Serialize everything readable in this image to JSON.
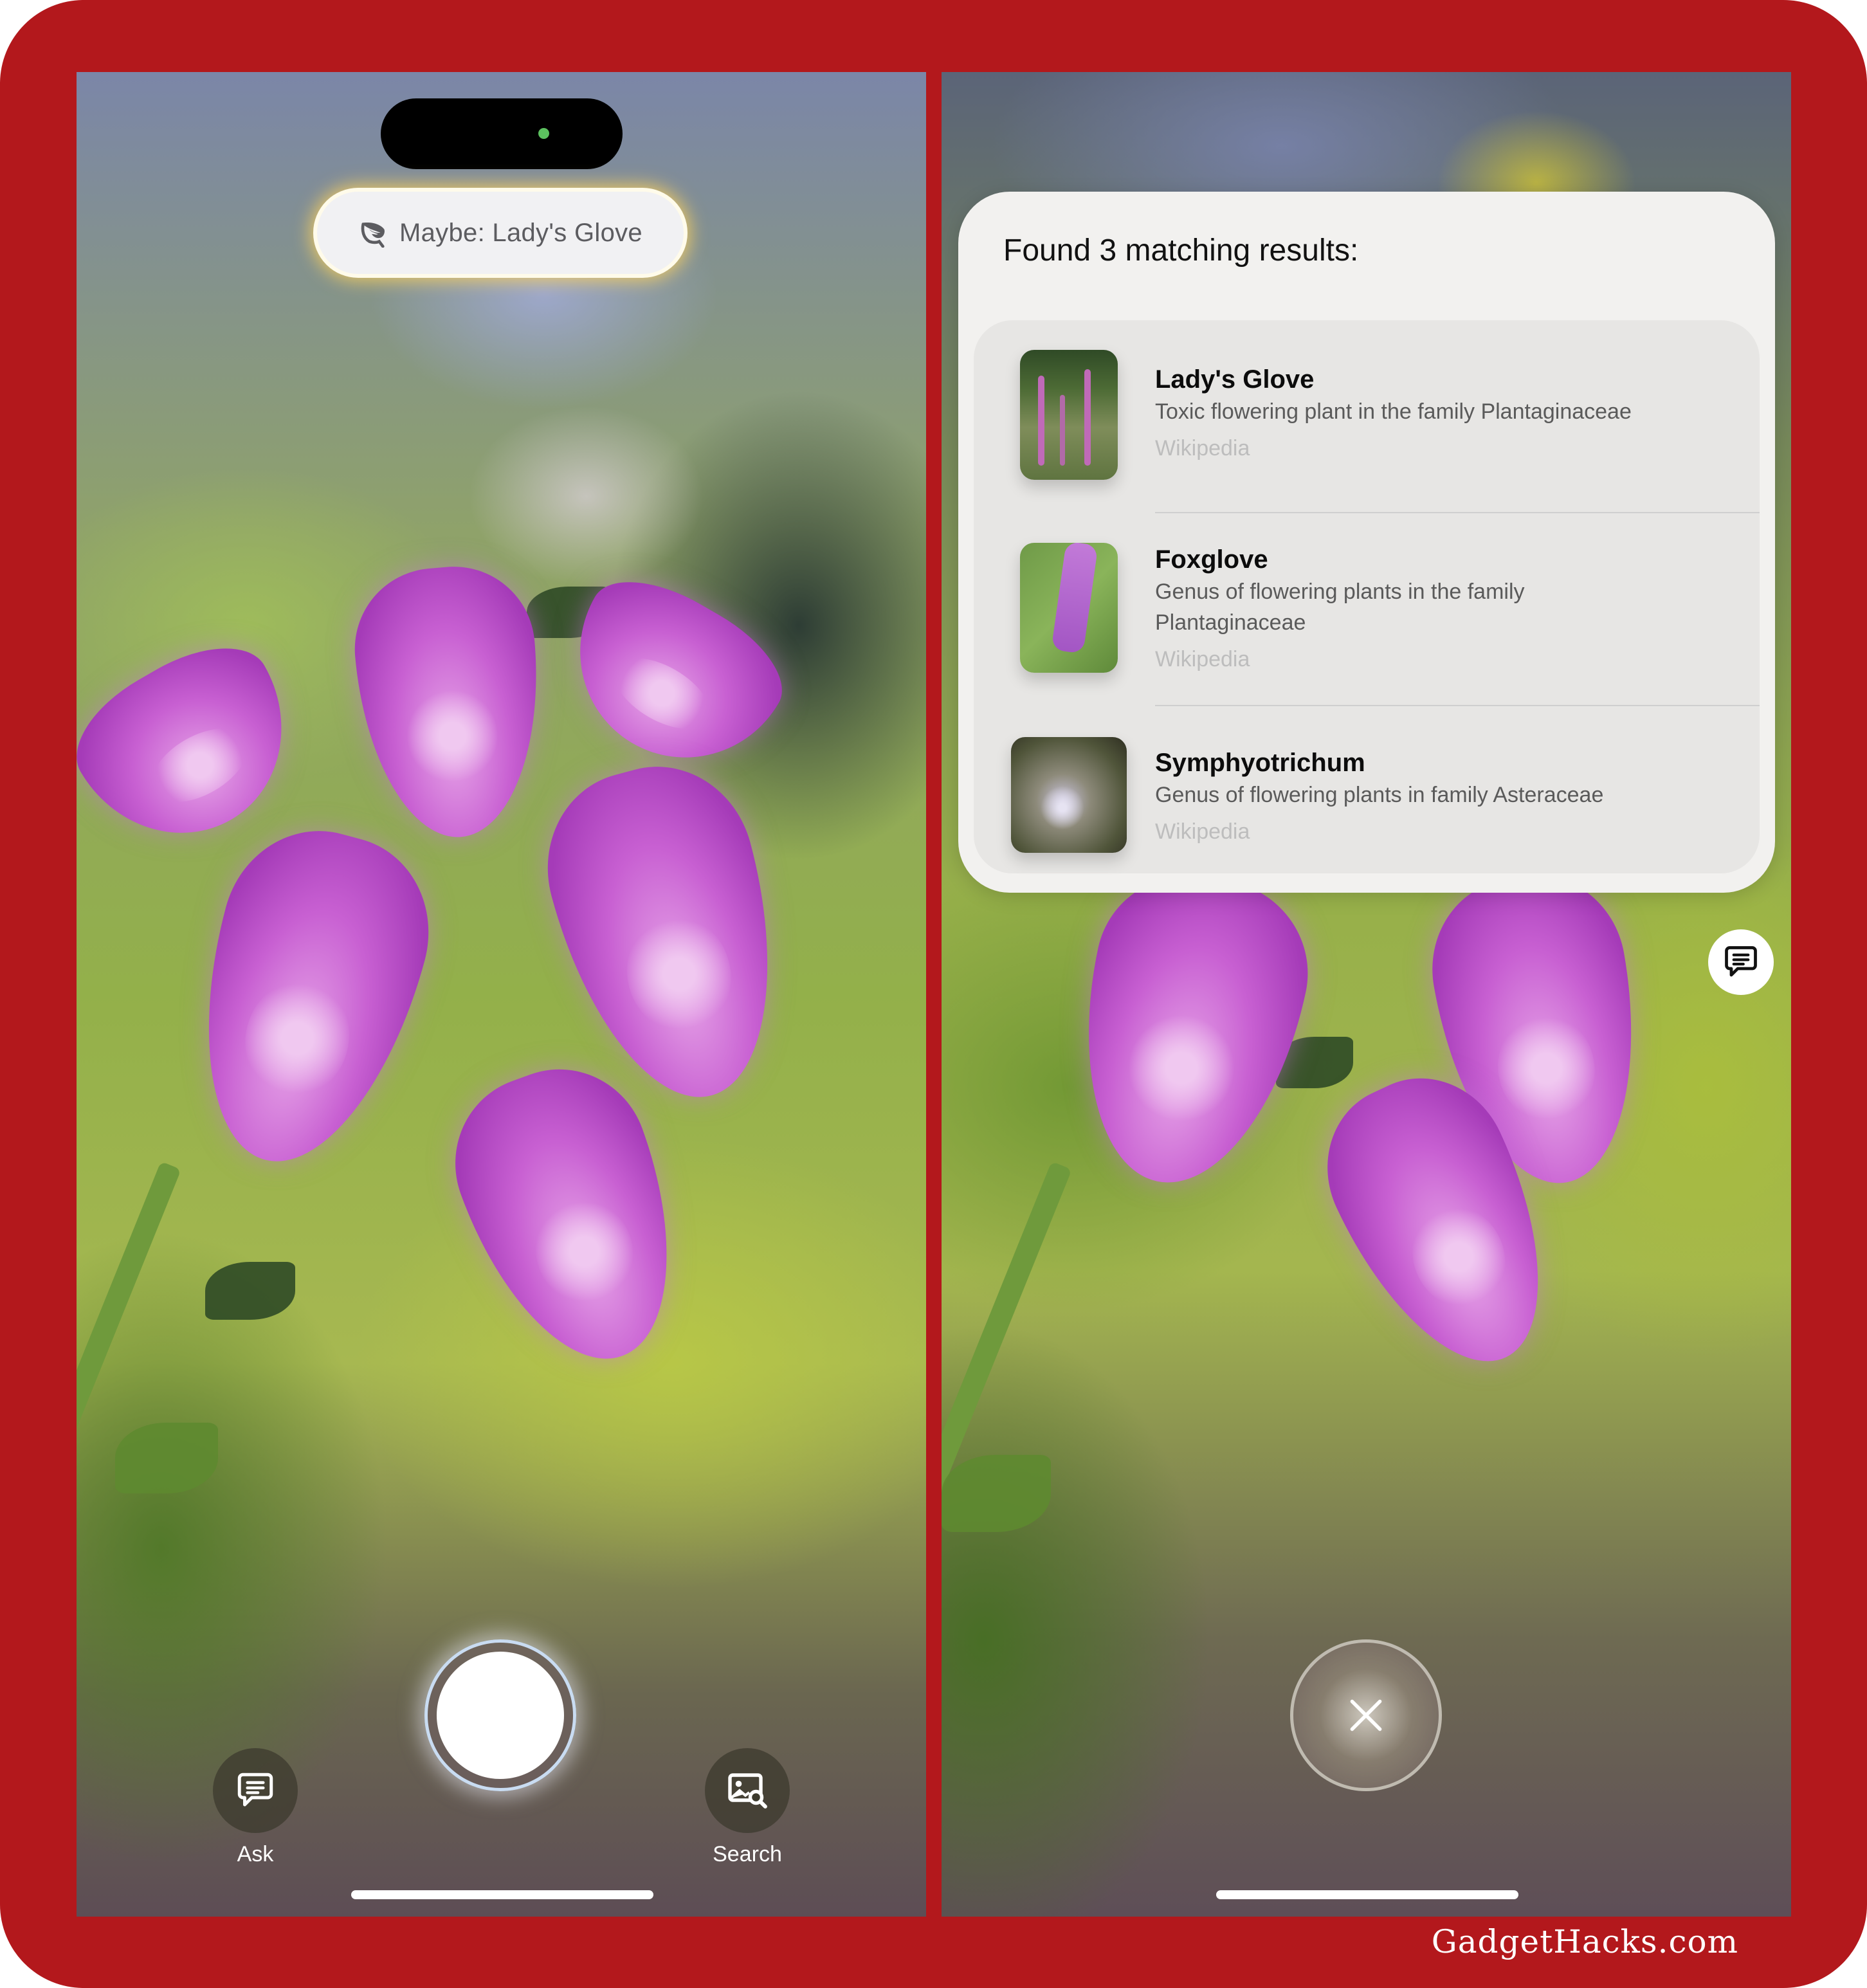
{
  "brand": {
    "frame_color": "#b3181c",
    "watermark": "GadgetHacks.com"
  },
  "left_screen": {
    "suggestion_pill": {
      "icon": "leaf-icon",
      "label": "Maybe: Lady's Glove",
      "glow_color": "#ffd25a"
    },
    "status_indicator_color": "#5cc15f",
    "controls": {
      "ask": {
        "icon": "chat-bubble-icon",
        "label": "Ask"
      },
      "shutter": {
        "icon": "shutter-icon"
      },
      "search": {
        "icon": "image-search-icon",
        "label": "Search"
      }
    }
  },
  "right_screen": {
    "results": {
      "title": "Found 3 matching results:",
      "items": [
        {
          "title": "Lady's Glove",
          "description": "Toxic flowering plant in the family Plantaginaceae",
          "source": "Wikipedia",
          "thumbnail": "foxglove-field-thumbnail"
        },
        {
          "title": "Foxglove",
          "description": "Genus of flowering plants in the family Plantaginaceae",
          "source": "Wikipedia",
          "thumbnail": "foxglove-closeup-thumbnail"
        },
        {
          "title": "Symphyotrichum",
          "description": "Genus of flowering plants in family Asteraceae",
          "source": "Wikipedia",
          "thumbnail": "aster-thumbnail"
        }
      ]
    },
    "controls": {
      "chat": {
        "icon": "chat-bubble-icon"
      },
      "close": {
        "icon": "close-icon"
      }
    }
  }
}
